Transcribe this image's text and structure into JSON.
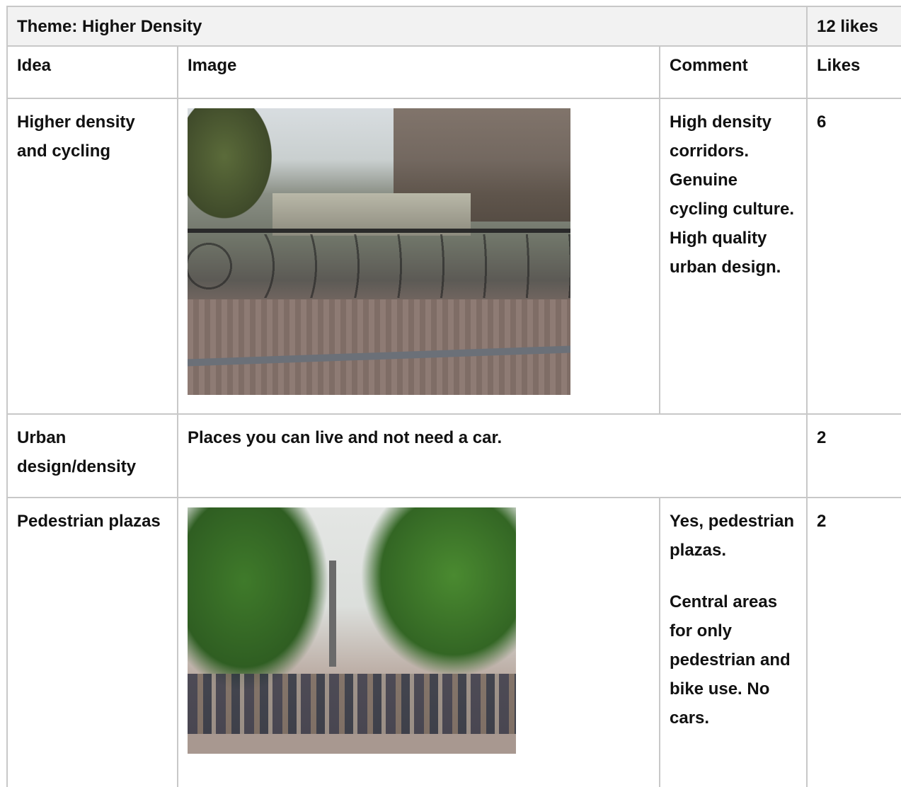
{
  "theme": {
    "title": "Theme: Higher Density",
    "likes": "12 likes"
  },
  "headers": {
    "idea": "Idea",
    "image": "Image",
    "comment": "Comment",
    "likes": "Likes"
  },
  "rows": [
    {
      "idea": "Higher density and cycling",
      "comment": "High density corridors. Genuine cycling culture.  High quality urban design.",
      "likes": "6"
    },
    {
      "idea": "Urban design/density",
      "comment": "Places you can live and not need a car.",
      "likes": "2"
    },
    {
      "idea": "Pedestrian plazas",
      "comment_p1": "Yes, pedestrian plazas.",
      "comment_p2": "Central areas for only pedestrian and bike use. No cars.",
      "likes": "2"
    }
  ]
}
